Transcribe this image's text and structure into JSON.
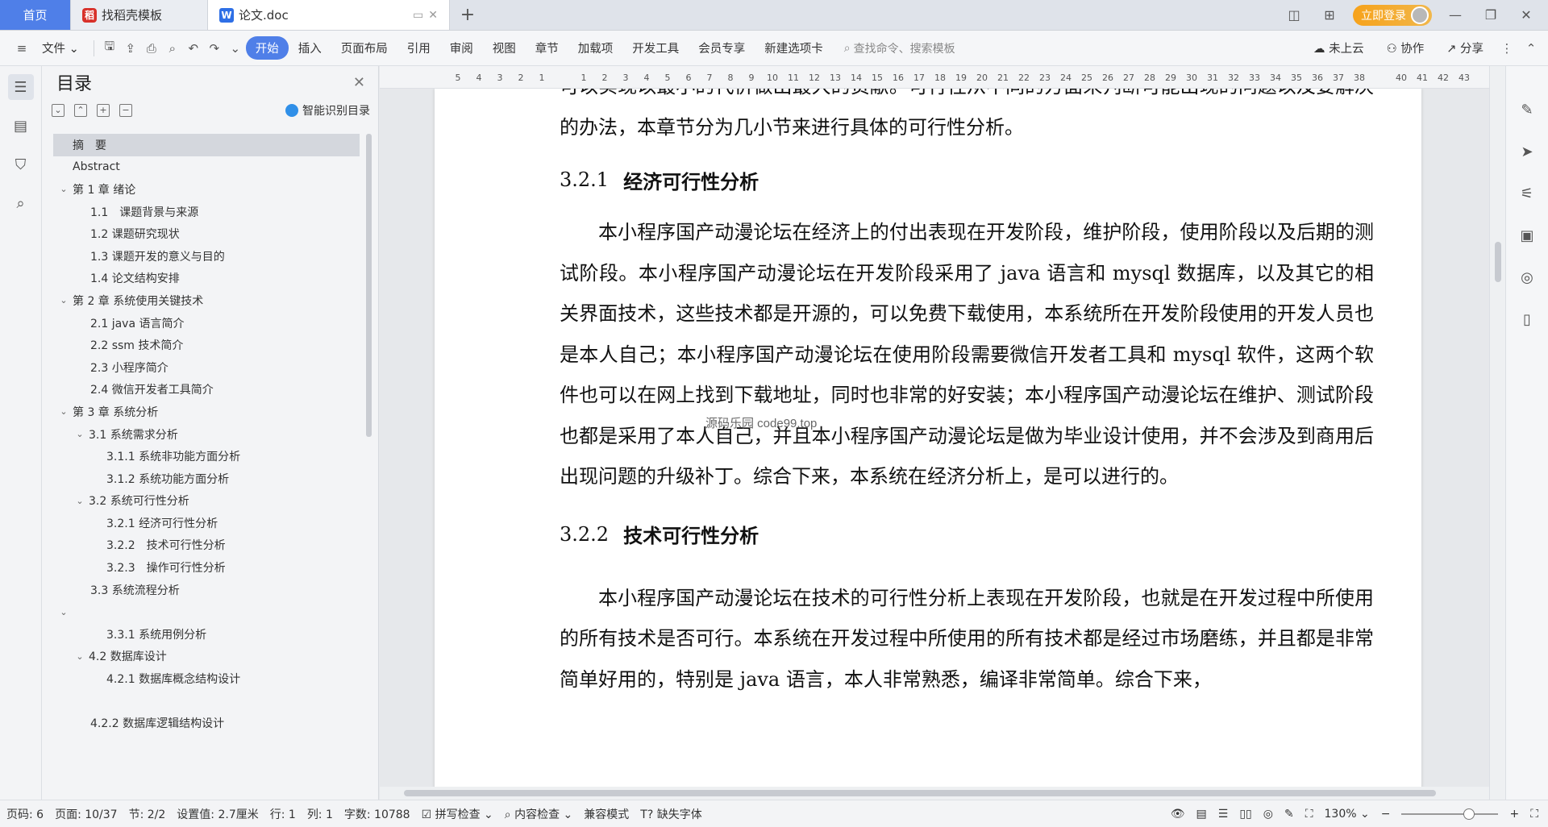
{
  "tabs": [
    {
      "label": "首页"
    },
    {
      "label": "找稻壳模板"
    },
    {
      "label": "论文.doc"
    }
  ],
  "titlebar": {
    "login_label": "立即登录"
  },
  "ribbon": {
    "file_label": "文件",
    "tabs": [
      "开始",
      "插入",
      "页面布局",
      "引用",
      "审阅",
      "视图",
      "章节",
      "加载项",
      "开发工具",
      "会员专享",
      "新建选项卡"
    ],
    "search_placeholder": "查找命令、搜索模板",
    "cloud_label": "未上云",
    "collab_label": "协作",
    "share_label": "分享"
  },
  "toc": {
    "title": "目录",
    "smart_label": "智能识别目录",
    "items": [
      {
        "label": "摘　要",
        "level": 0,
        "chevron": false
      },
      {
        "label": "Abstract",
        "level": 0,
        "chevron": false
      },
      {
        "label": "第 1 章  绪论",
        "level": 0,
        "chevron": true
      },
      {
        "label": "1.1　课题背景与来源",
        "level": 1,
        "chevron": false
      },
      {
        "label": "1.2  课题研究现状",
        "level": 1,
        "chevron": false
      },
      {
        "label": "1.3 课题开发的意义与目的",
        "level": 1,
        "chevron": false
      },
      {
        "label": "1.4 论文结构安排",
        "level": 1,
        "chevron": false
      },
      {
        "label": "第 2 章  系统使用关键技术",
        "level": 0,
        "chevron": true
      },
      {
        "label": "2.1 java 语言简介",
        "level": 1,
        "chevron": false
      },
      {
        "label": "2.2 ssm 技术简介",
        "level": 1,
        "chevron": false
      },
      {
        "label": "2.3  小程序简介",
        "level": 1,
        "chevron": false
      },
      {
        "label": "2.4  微信开发者工具简介",
        "level": 1,
        "chevron": false
      },
      {
        "label": "第 3 章  系统分析",
        "level": 0,
        "chevron": true
      },
      {
        "label": "3.1  系统需求分析",
        "level": 1,
        "chevron": true
      },
      {
        "label": "3.1.1 系统非功能方面分析",
        "level": 2,
        "chevron": false
      },
      {
        "label": "3.1.2 系统功能方面分析",
        "level": 2,
        "chevron": false
      },
      {
        "label": "3.2 系统可行性分析",
        "level": 1,
        "chevron": true
      },
      {
        "label": "3.2.1  经济可行性分析",
        "level": 2,
        "chevron": false
      },
      {
        "label": "3.2.2　技术可行性分析",
        "level": 2,
        "chevron": false
      },
      {
        "label": "3.2.3　操作可行性分析",
        "level": 2,
        "chevron": false
      },
      {
        "label": "3.3 系统流程分析",
        "level": 1,
        "chevron": false
      },
      {
        "label": "",
        "level": 0,
        "chevron": true
      },
      {
        "label": "3.3.1 系统用例分析",
        "level": 2,
        "chevron": false
      },
      {
        "label": "4.2 数据库设计",
        "level": 1,
        "chevron": true
      },
      {
        "label": "4.2.1 数据库概念结构设计",
        "level": 2,
        "chevron": false
      },
      {
        "label": "",
        "level": 0,
        "chevron": false
      },
      {
        "label": "4.2.2 数据库逻辑结构设计",
        "level": 1,
        "chevron": false
      }
    ]
  },
  "ruler": [
    "5",
    "4",
    "3",
    "2",
    "1",
    "",
    "1",
    "2",
    "3",
    "4",
    "5",
    "6",
    "7",
    "8",
    "9",
    "10",
    "11",
    "12",
    "13",
    "14",
    "15",
    "16",
    "17",
    "18",
    "19",
    "20",
    "21",
    "22",
    "23",
    "24",
    "25",
    "26",
    "27",
    "28",
    "29",
    "30",
    "31",
    "32",
    "33",
    "34",
    "35",
    "36",
    "37",
    "38",
    "",
    "40",
    "41",
    "42",
    "43"
  ],
  "document": {
    "para_top": "可以实现以最小的代价做出最大的贡献。可行性从不同的方面来判断可能出现的问题以及要解决的办法，本章节分为几小节来进行具体的可行性分析。",
    "h1_num": "3.2.1",
    "h1_text": "经济可行性分析",
    "para_econ": "本小程序国产动漫论坛在经济上的付出表现在开发阶段，维护阶段，使用阶段以及后期的测试阶段。本小程序国产动漫论坛在开发阶段采用了 java 语言和 mysql 数据库，以及其它的相关界面技术，这些技术都是开源的，可以免费下载使用，本系统所在开发阶段使用的开发人员也是本人自己；本小程序国产动漫论坛在使用阶段需要微信开发者工具和 mysql 软件，这两个软件也可以在网上找到下载地址，同时也非常的好安装；本小程序国产动漫论坛在维护、测试阶段也都是采用了本人自己，并且本小程序国产动漫论坛是做为毕业设计使用，并不会涉及到商用后出现问题的升级补丁。综合下来，本系统在经济分析上，是可以进行的。",
    "h2_num": "3.2.2",
    "h2_text": "技术可行性分析",
    "para_tech": "本小程序国产动漫论坛在技术的可行性分析上表现在开发阶段，也就是在开发过程中所使用的所有技术是否可行。本系统在开发过程中所使用的所有技术都是经过市场磨练，并且都是非常简单好用的，特别是 java 语言，本人非常熟悉，编译非常简单。综合下来，",
    "watermark": "源码乐园 code99.top"
  },
  "status": {
    "page_no": "页码: 6",
    "pages": "页面: 10/37",
    "section": "节: 2/2",
    "setting": "设置值: 2.7厘米",
    "row": "行: 1",
    "col": "列: 1",
    "words": "字数: 10788",
    "spell": "拼写检查",
    "content_check": "内容检查",
    "compat": "兼容模式",
    "missing_font": "缺失字体",
    "zoom": "130%",
    "zoom_level": 0.7
  }
}
